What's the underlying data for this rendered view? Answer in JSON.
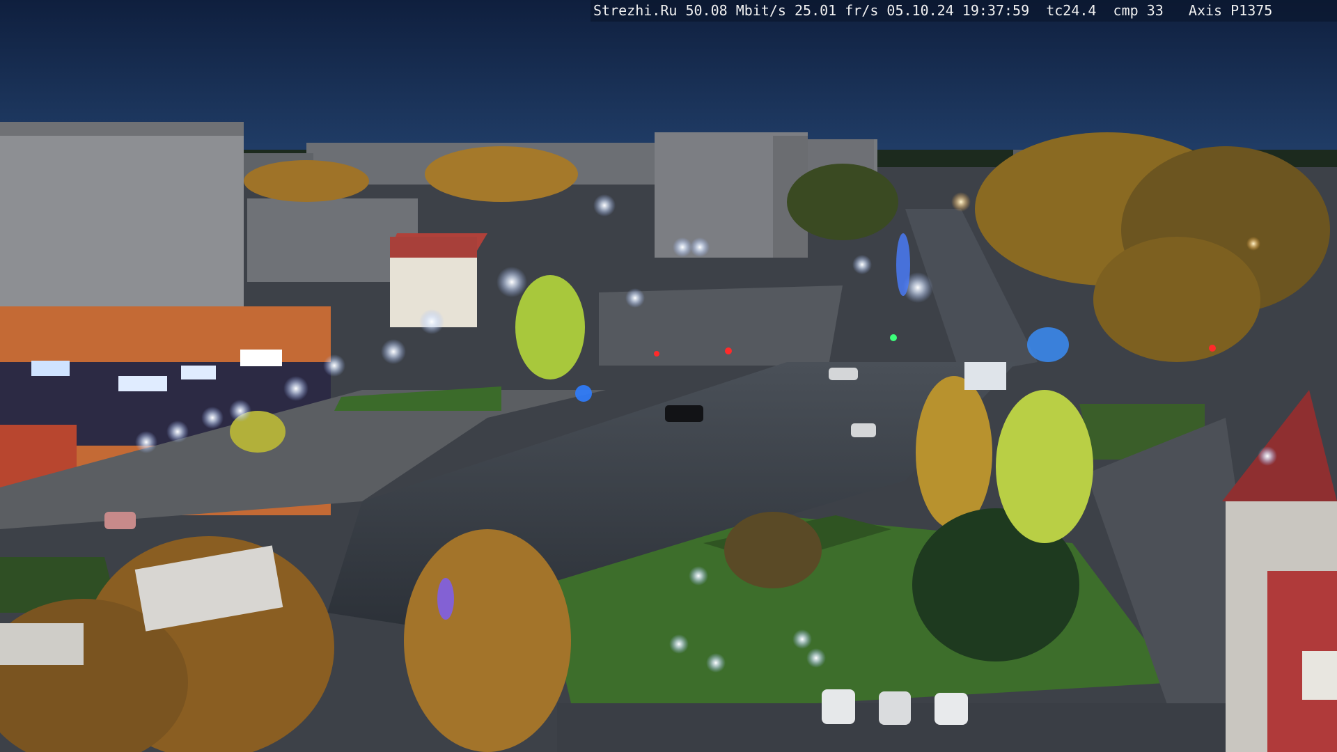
{
  "camera_overlay": {
    "text": "Strezhi.Ru 50.08 Mbit/s 25.01 fr/s 05.10.24 19:37:59  tc24.4  cmp 33   Axis P1375"
  },
  "scene": {
    "description_kind": "night-webcam-city-street",
    "colors": {
      "sky": "#12254a",
      "sky_horizon": "#1c3560",
      "asphalt": "#3a3f47",
      "grass": "#3b6b2a",
      "autumn_tree": "#b8862e",
      "green_tree": "#9ec23a",
      "street_light": "#e8f2ff",
      "building": "#8a8c90",
      "red_building": "#b0413a",
      "traffic_red": "#ff2a2a"
    }
  }
}
